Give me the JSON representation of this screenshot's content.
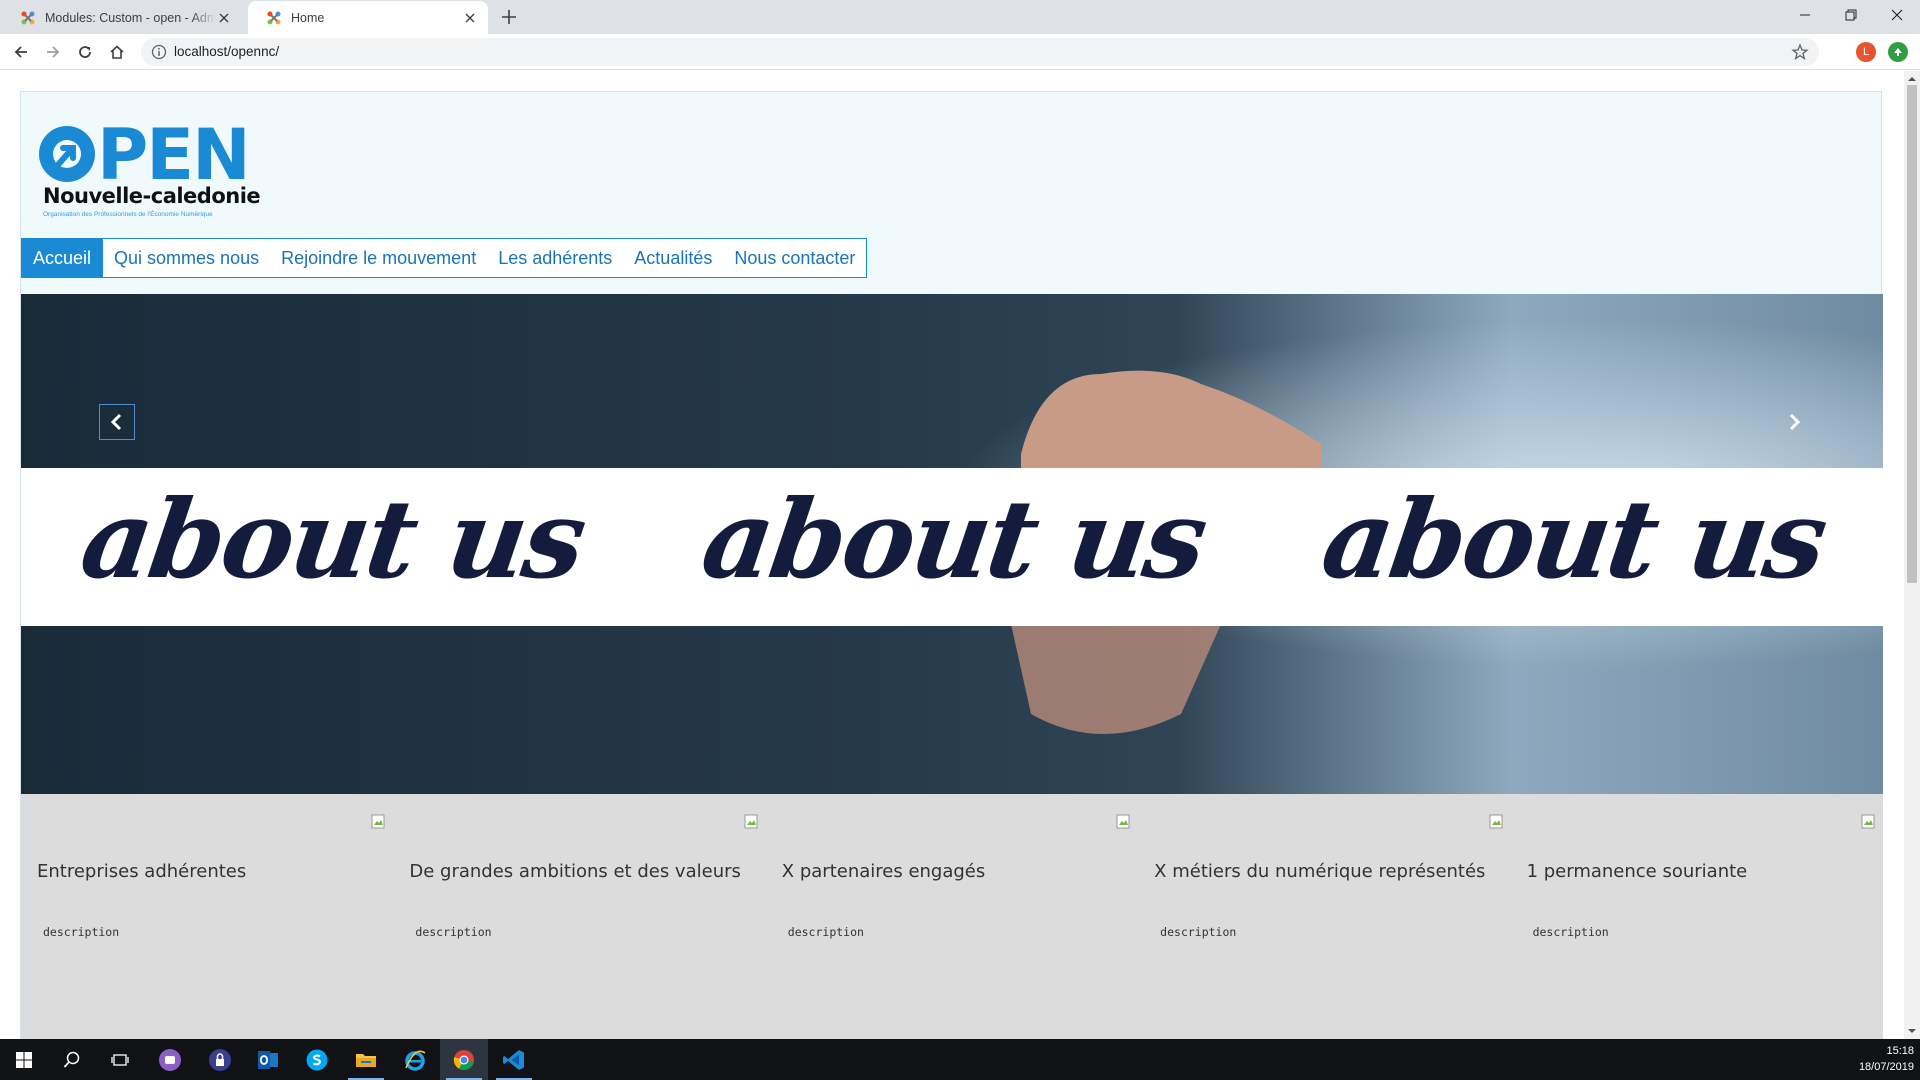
{
  "browser": {
    "tabs": [
      {
        "title": "Modules: Custom - open - Administration",
        "active": false
      },
      {
        "title": "Home",
        "active": true
      }
    ],
    "url": "localhost/opennc/",
    "profile_initial": "L"
  },
  "site": {
    "logo": {
      "wordmark": "PEN",
      "subtitle": "Nouvelle-caledonie",
      "tagline": "Organisation des Professionnels de l'Économie Numérique"
    },
    "nav": [
      {
        "label": "Accueil",
        "active": true
      },
      {
        "label": "Qui sommes nous",
        "active": false
      },
      {
        "label": "Rejoindre le mouvement",
        "active": false
      },
      {
        "label": "Les adhérents",
        "active": false
      },
      {
        "label": "Actualités",
        "active": false
      },
      {
        "label": "Nous contacter",
        "active": false
      }
    ],
    "carousel": {
      "banner_words": [
        "about us",
        "about us",
        "about us"
      ]
    },
    "features": [
      {
        "title": "Entreprises adhérentes",
        "description": "description"
      },
      {
        "title": "De grandes ambitions et des valeurs",
        "description": "description"
      },
      {
        "title": "X partenaires engagés",
        "description": "description"
      },
      {
        "title": "X métiers du numérique représentés",
        "description": "description"
      },
      {
        "title": "1 permanence souriante",
        "description": "description"
      }
    ]
  },
  "taskbar": {
    "apps": [
      "start",
      "search",
      "task-view",
      "app-purple",
      "app-lock",
      "outlook",
      "skype",
      "file-explorer",
      "internet-explorer",
      "chrome",
      "vscode"
    ],
    "time": "15:18",
    "date": "18/07/2019"
  },
  "colors": {
    "brand_blue": "#1a8ad4",
    "nav_text": "#1a74b8",
    "site_bg": "#f0f9fc",
    "feature_bg": "#dcdcdc",
    "banner_text": "#131c3c"
  }
}
